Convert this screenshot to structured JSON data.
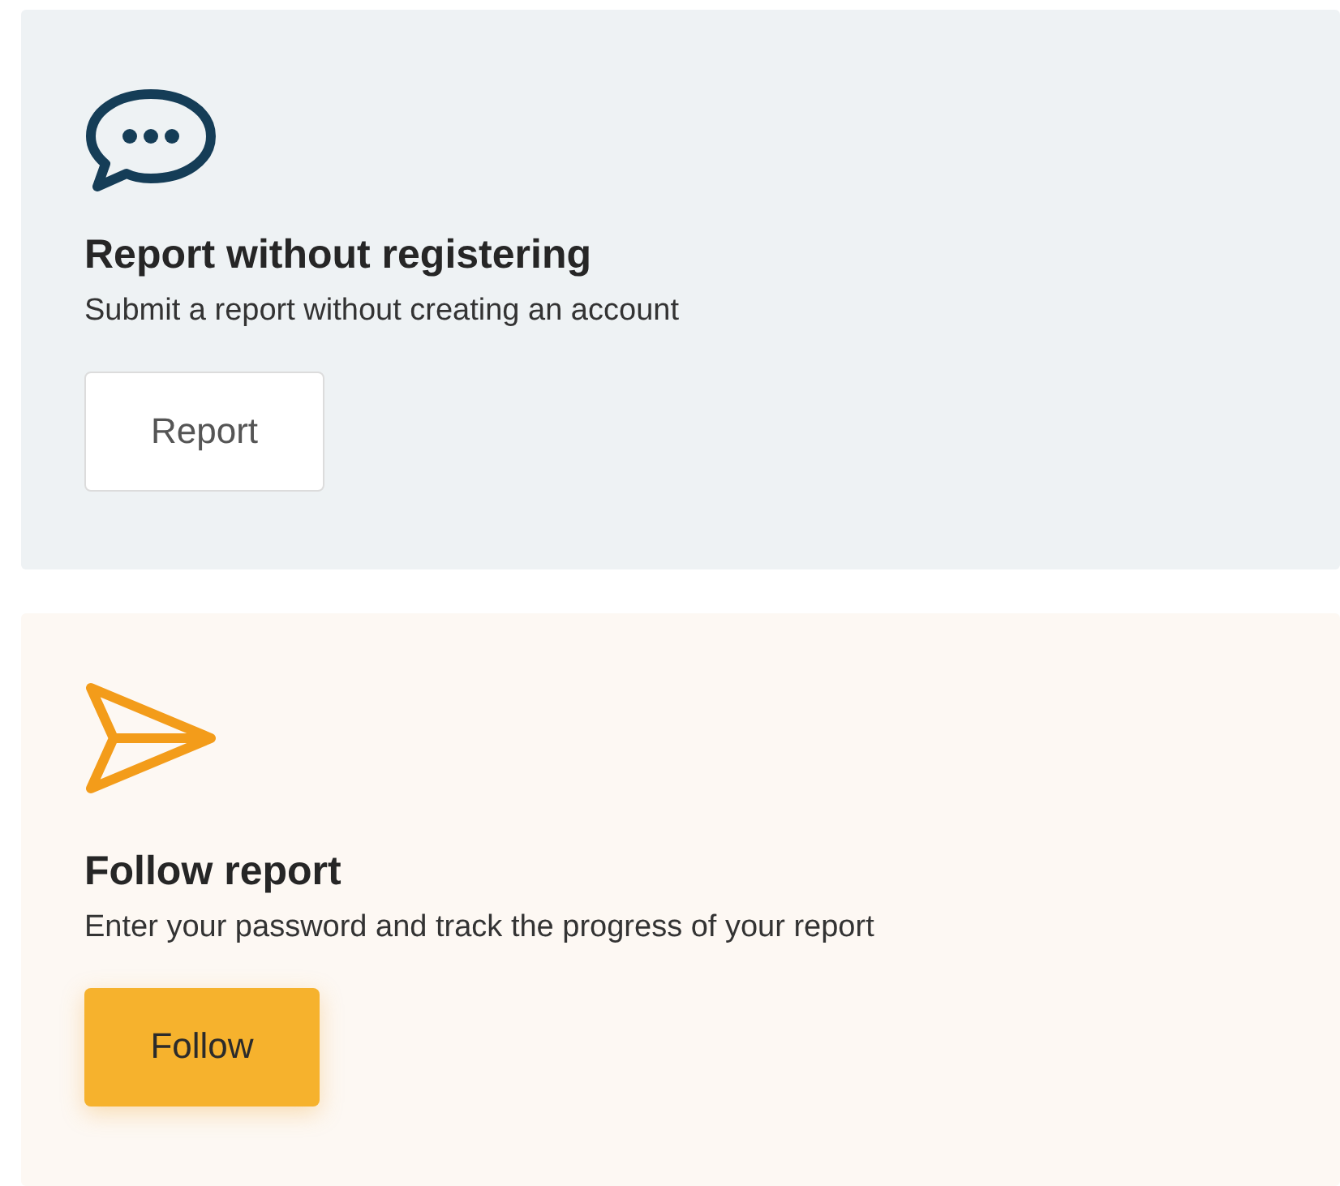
{
  "cards": [
    {
      "kind": "chat",
      "title": "Report without registering",
      "description": "Submit a report without creating an account",
      "button": {
        "label": "Report",
        "kind": "secondary"
      }
    },
    {
      "kind": "send",
      "title": "Follow report",
      "description": "Enter your password and track the progress of your report",
      "button": {
        "label": "Follow",
        "kind": "primary"
      }
    }
  ]
}
